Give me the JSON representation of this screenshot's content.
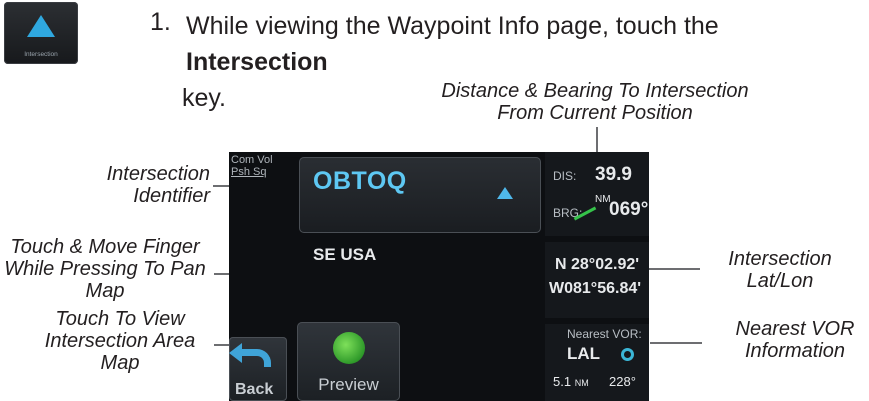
{
  "key": {
    "label": "Intersection"
  },
  "step": {
    "number": "1.",
    "text_before": "While viewing the Waypoint Info page, touch the ",
    "bold": "Intersection",
    "text_after": " key."
  },
  "callouts": {
    "distance_bearing": "Distance & Bearing To Intersection From Current Position",
    "identifier": "Intersection Identifier",
    "pan_map": "Touch & Move Finger While Pressing To Pan Map",
    "area_map": "Touch To View Intersection Area Map",
    "lat_lon": "Intersection Lat/Lon",
    "nearest_vor": "Nearest VOR Information"
  },
  "screen": {
    "com_vol_line1": "Com Vol",
    "com_vol_line2": "Psh Sq",
    "identifier": "OBTOQ",
    "region": "SE USA",
    "dis_label": "DIS:",
    "dis_value": "39.9",
    "dis_unit": "NM",
    "brg_label": "BRG:",
    "brg_value": "069°",
    "lat": "N 28°02.92'",
    "lon": "W081°56.84'",
    "nearest_vor_label": "Nearest VOR:",
    "vor_ident": "LAL",
    "vor_dist": "5.1",
    "vor_unit": "NM",
    "vor_brg": "228°",
    "back_label": "Back",
    "preview_label": "Preview"
  }
}
